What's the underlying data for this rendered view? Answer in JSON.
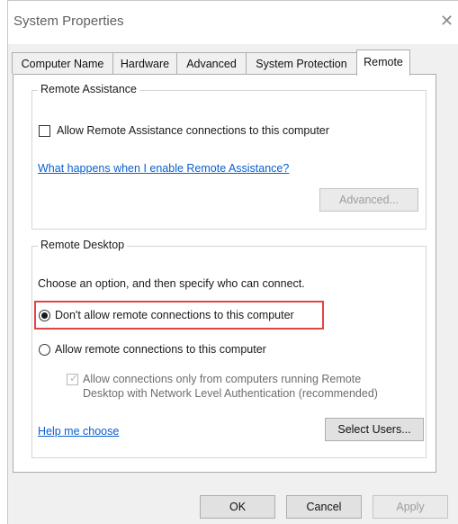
{
  "window": {
    "title": "System Properties",
    "close_icon": "close-icon"
  },
  "tabs": [
    {
      "label": "Computer Name",
      "active": false
    },
    {
      "label": "Hardware",
      "active": false
    },
    {
      "label": "Advanced",
      "active": false
    },
    {
      "label": "System Protection",
      "active": false
    },
    {
      "label": "Remote",
      "active": true
    }
  ],
  "remote_assistance": {
    "group_label": "Remote Assistance",
    "checkbox_label": "Allow Remote Assistance connections to this computer",
    "checkbox_checked": false,
    "help_link": "What happens when I enable Remote Assistance?",
    "advanced_button": "Advanced...",
    "advanced_enabled": false
  },
  "remote_desktop": {
    "group_label": "Remote Desktop",
    "instruction": "Choose an option, and then specify who can connect.",
    "option_dont_allow": "Don't allow remote connections to this computer",
    "option_allow": "Allow remote connections to this computer",
    "selected_option": "dont_allow",
    "nla_line1": "Allow connections only from computers running Remote",
    "nla_line2": "Desktop with Network Level Authentication (recommended)",
    "nla_checked": true,
    "nla_enabled": false,
    "help_link": "Help me choose",
    "select_users_button": "Select Users..."
  },
  "footer": {
    "ok": "OK",
    "cancel": "Cancel",
    "apply": "Apply",
    "apply_enabled": false
  },
  "colors": {
    "link": "#0b5fcf",
    "highlight_border": "#e04545",
    "dialog_background": "#f0f0f0"
  }
}
